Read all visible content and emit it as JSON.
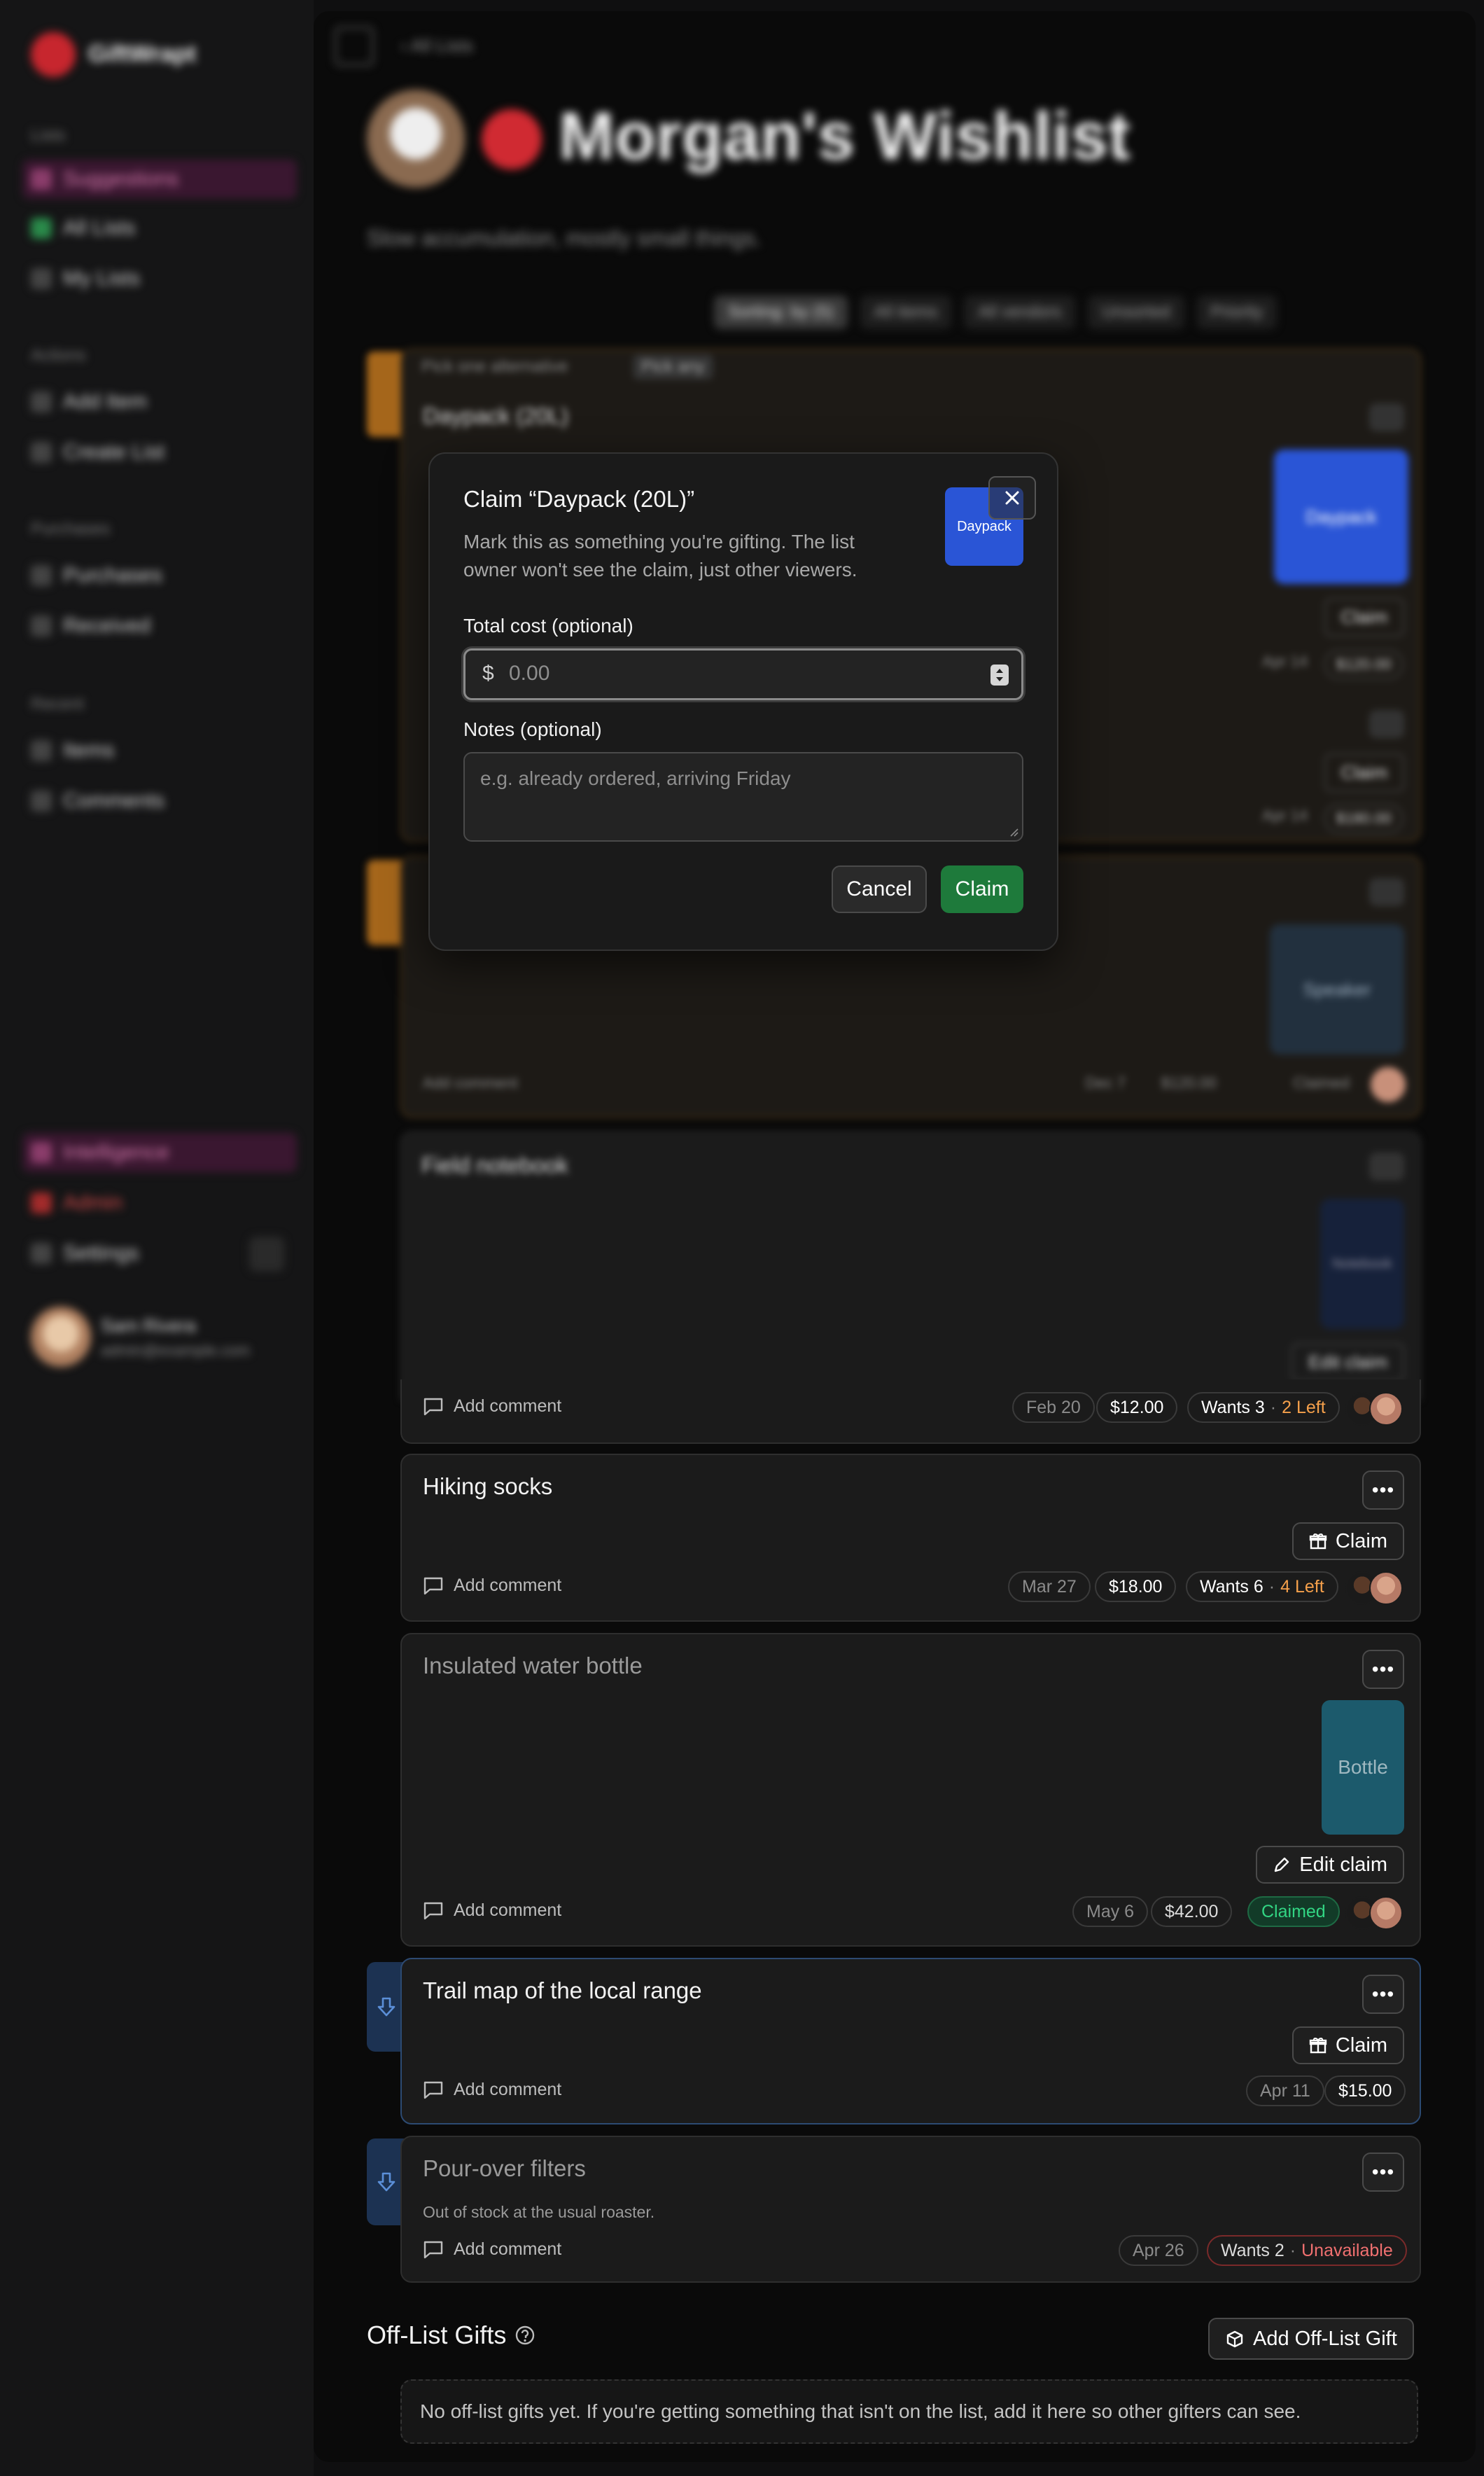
{
  "app": {
    "name": "GiftWrapt"
  },
  "sidebar": {
    "sections": [
      {
        "title": "Lists",
        "items": [
          "Suggestions",
          "All Lists",
          "My Lists"
        ]
      },
      {
        "title": "Actions",
        "items": [
          "Add Item",
          "Create List"
        ]
      },
      {
        "title": "Purchases",
        "items": [
          "Purchases",
          "Received"
        ]
      },
      {
        "title": "Recent",
        "items": [
          "Items",
          "Comments"
        ]
      }
    ],
    "bottom_items": [
      "Intelligence",
      "Admin",
      "Settings"
    ],
    "user": {
      "name": "Sam Rivera",
      "email": "admin@example.com"
    }
  },
  "header": {
    "breadcrumb": "All Lists",
    "title": "Morgan's Wishlist",
    "subtitle": "Slow accumulation, mostly small things.",
    "filters": [
      "Sorting: by (5)",
      "All items",
      "All vendors",
      "Unsorted",
      "Priority"
    ]
  },
  "modal": {
    "title": "Claim “Daypack (20L)”",
    "description": "Mark this as something you're gifting. The list owner won't see the claim, just other viewers.",
    "thumb_label": "Daypack",
    "cost_label": "Total cost (optional)",
    "currency": "$",
    "cost_placeholder": "0.00",
    "notes_label": "Notes (optional)",
    "notes_placeholder": "e.g. already ordered, arriving Friday",
    "cancel": "Cancel",
    "claim": "Claim"
  },
  "background_cards": {
    "group_note": "Pick one alternative",
    "group_pill": "Pick any",
    "daypack": {
      "title": "Daypack (20L)",
      "thumb": "Daypack",
      "claim": "Claim",
      "date": "Apr 14",
      "price": "$120.00"
    },
    "option2": {
      "claim": "Claim",
      "date": "Apr 14",
      "price": "$180.00"
    },
    "speaker": {
      "thumb": "Speaker",
      "comment": "Add comment",
      "date": "Dec 7",
      "price": "$120.00",
      "status": "Claimed"
    },
    "notebook": {
      "title": "Field notebook",
      "thumb": "Notebook",
      "edit": "Edit claim"
    }
  },
  "items": [
    {
      "title": "Field notebook",
      "comment": "Add comment",
      "date": "Feb 20",
      "price": "$12.00",
      "wants": "Wants 3",
      "left": "2 Left"
    },
    {
      "title": "Hiking socks",
      "claim": "Claim",
      "comment": "Add comment",
      "date": "Mar 27",
      "price": "$18.00",
      "wants": "Wants 6",
      "left": "4 Left"
    },
    {
      "title": "Insulated water bottle",
      "thumb": "Bottle",
      "edit": "Edit claim",
      "comment": "Add comment",
      "date": "May 6",
      "price": "$42.00",
      "status": "Claimed"
    },
    {
      "title": "Trail map of the local range",
      "claim": "Claim",
      "comment": "Add comment",
      "date": "Apr 11",
      "price": "$15.00"
    },
    {
      "title": "Pour-over filters",
      "note": "Out of stock at the usual roaster.",
      "comment": "Add comment",
      "date": "Apr 26",
      "wants": "Wants 2",
      "status": "Unavailable"
    }
  ],
  "off_list": {
    "title": "Off-List Gifts",
    "add_button": "Add Off-List Gift",
    "empty": "No off-list gifts yet. If you're getting something that isn't on the list, add it here so other gifters can see."
  },
  "colors": {
    "accent_green": "#1e7a3b",
    "claimed": "#32d583",
    "left_orange": "#f5a04b",
    "unavailable": "#f07070",
    "blue_thumb": "#2a55d6",
    "teal_thumb": "#1c5a6c"
  }
}
